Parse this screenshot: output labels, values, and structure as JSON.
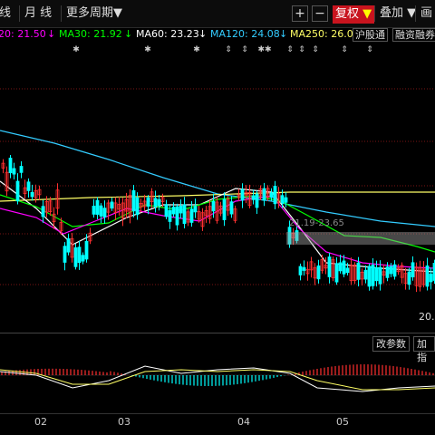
{
  "toolbar": {
    "line_label": "线",
    "month_label": "月 线",
    "more_period": "更多周期",
    "more_period_caret": "▼",
    "plus": "+",
    "minus": "−",
    "fuquan_label": "复权",
    "fuquan_caret": "▼",
    "overlay_label": "叠加",
    "overlay_caret": "▼",
    "draw_label": "画"
  },
  "ma_legend": {
    "ma20": "20: 21.50",
    "ma20_arrow": "↓",
    "ma30": "MA30: 21.92",
    "ma30_arrow": "↓",
    "ma60": "MA60: 23.23",
    "ma60_arrow": "↓",
    "ma120": "MA120: 24.08",
    "ma120_arrow": "↓",
    "ma250": "MA250: 26.0",
    "colors": {
      "ma20": "#ff00ff",
      "ma30": "#00ff00",
      "ma60": "#ffffff",
      "ma120": "#33ccff",
      "ma250": "#ffff66"
    }
  },
  "tags": {
    "hugutong": "沪股通",
    "rongzi": "融资融券"
  },
  "annotations": {
    "range_label": "21.19-23.65",
    "price_label": "20."
  },
  "sub_buttons": {
    "params": "改参数",
    "add_indicator": "加指"
  },
  "x_axis": [
    "02",
    "03",
    "04",
    "05"
  ],
  "colors": {
    "up": "#ff3030",
    "down": "#00ffff",
    "grid": "#7a1414"
  }
}
